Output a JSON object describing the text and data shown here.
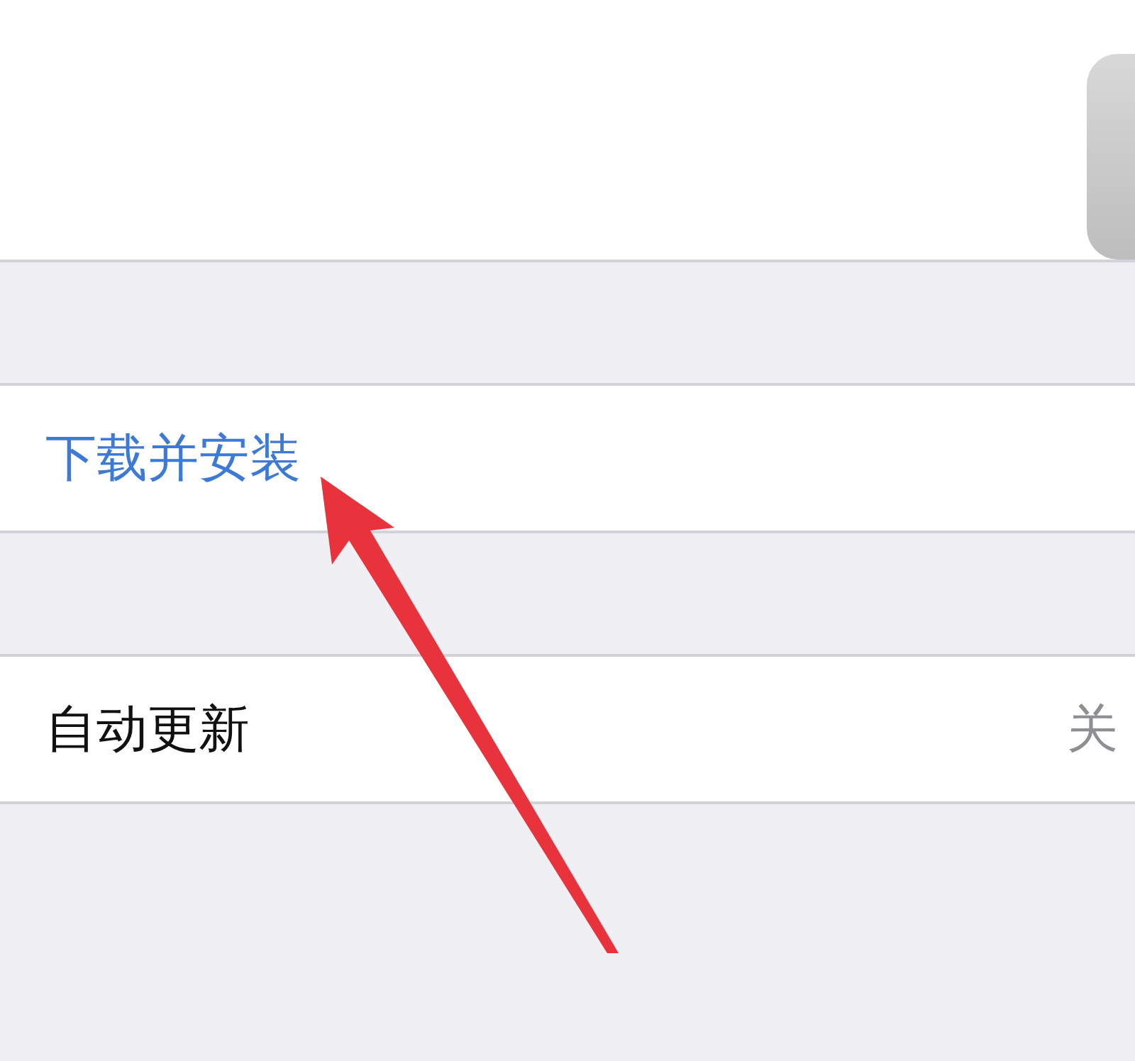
{
  "groups": [
    {
      "kind": "action",
      "label": "下载并安装"
    },
    {
      "kind": "setting",
      "label": "自动更新",
      "value": "关"
    }
  ]
}
